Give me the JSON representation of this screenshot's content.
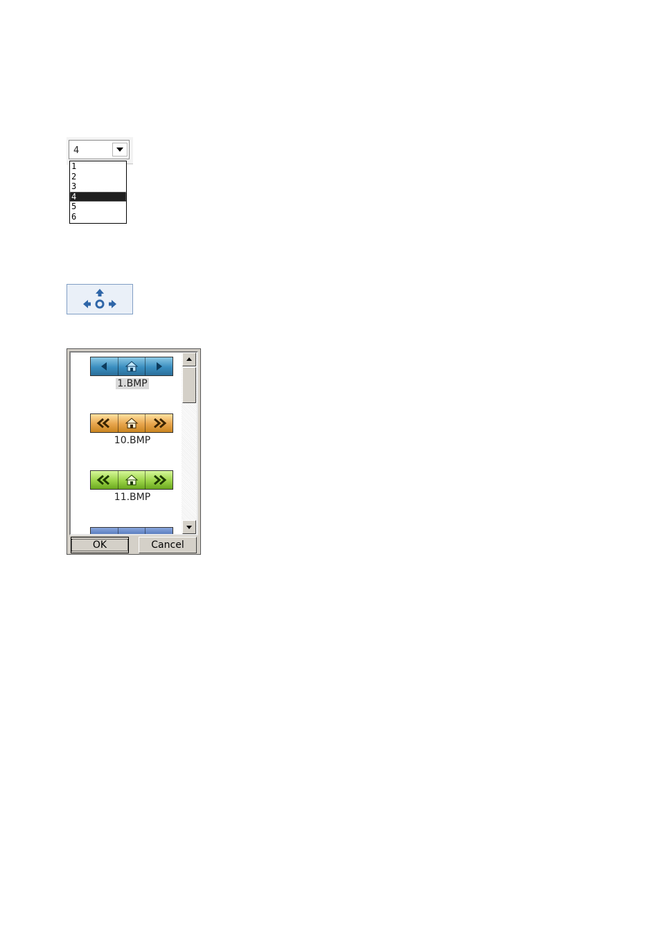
{
  "dropdown": {
    "selected_value": "4",
    "options": [
      "1",
      "2",
      "3",
      "4",
      "5",
      "6"
    ],
    "highlighted_index": 3
  },
  "navigation_button": {
    "icon": "four-direction-arrows-icon"
  },
  "image_picker": {
    "items": [
      {
        "label": "1.BMP",
        "style": "blue",
        "selected": true
      },
      {
        "label": "10.BMP",
        "style": "orange",
        "selected": false
      },
      {
        "label": "11.BMP",
        "style": "green",
        "selected": false
      },
      {
        "label": "",
        "style": "darkblue",
        "selected": false
      }
    ],
    "ok_label": "OK",
    "cancel_label": "Cancel"
  },
  "colors": {
    "selection_bg": "#1f1f1f",
    "nav_arrow": "#2f66a8",
    "dialog_face": "#d4d0c8"
  }
}
